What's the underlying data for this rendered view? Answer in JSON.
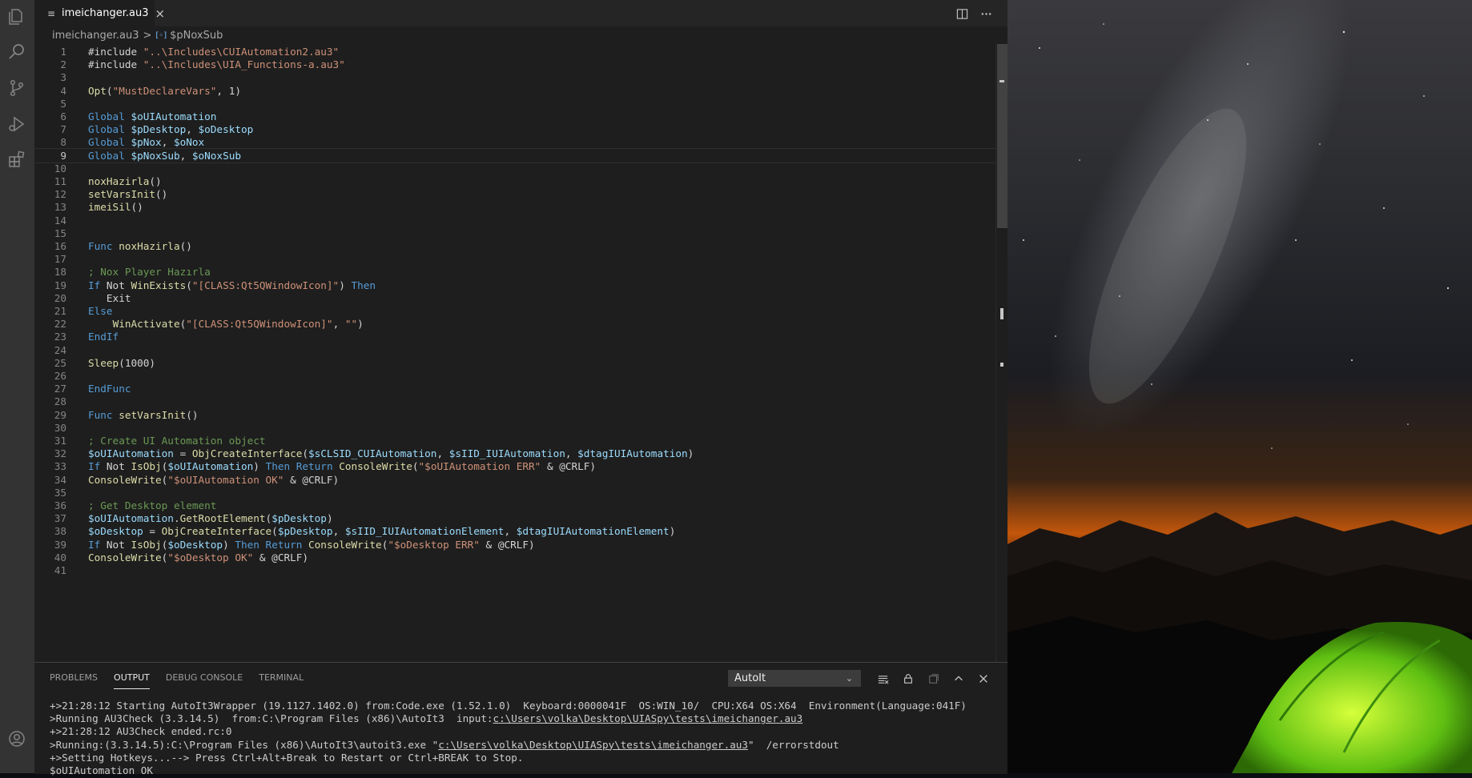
{
  "editor": {
    "tab_name": "imeichanger.au3",
    "tab_close_glyph": "×",
    "breadcrumb": {
      "file": "imeichanger.au3",
      "separator": ">",
      "symbol": "$pNoxSub"
    },
    "current_line": 9,
    "lines": [
      {
        "n": "1",
        "t": [
          [
            "pp",
            "#include "
          ],
          [
            "str",
            "\"..\\Includes\\CUIAutomation2.au3\""
          ]
        ]
      },
      {
        "n": "2",
        "t": [
          [
            "pp",
            "#include "
          ],
          [
            "str",
            "\"..\\Includes\\UIA_Functions-a.au3\""
          ]
        ]
      },
      {
        "n": "3",
        "t": []
      },
      {
        "n": "4",
        "t": [
          [
            "fn",
            "Opt"
          ],
          [
            "p",
            "("
          ],
          [
            "str",
            "\"MustDeclareVars\""
          ],
          [
            "p",
            ", 1)"
          ]
        ]
      },
      {
        "n": "5",
        "t": []
      },
      {
        "n": "6",
        "t": [
          [
            "kw",
            "Global "
          ],
          [
            "var",
            "$oUIAutomation"
          ]
        ]
      },
      {
        "n": "7",
        "t": [
          [
            "kw",
            "Global "
          ],
          [
            "var",
            "$pDesktop"
          ],
          [
            "p",
            ", "
          ],
          [
            "var",
            "$oDesktop"
          ]
        ]
      },
      {
        "n": "8",
        "t": [
          [
            "kw",
            "Global "
          ],
          [
            "var",
            "$pNox"
          ],
          [
            "p",
            ", "
          ],
          [
            "var",
            "$oNox"
          ]
        ]
      },
      {
        "n": "9",
        "t": [
          [
            "kw",
            "Global "
          ],
          [
            "var",
            "$pNoxSub"
          ],
          [
            "p",
            ", "
          ],
          [
            "var",
            "$oNoxSub"
          ]
        ]
      },
      {
        "n": "10",
        "t": []
      },
      {
        "n": "11",
        "t": [
          [
            "fn",
            "noxHazirla"
          ],
          [
            "p",
            "()"
          ]
        ]
      },
      {
        "n": "12",
        "t": [
          [
            "fn",
            "setVarsInit"
          ],
          [
            "p",
            "()"
          ]
        ]
      },
      {
        "n": "13",
        "t": [
          [
            "fn",
            "imeiSil"
          ],
          [
            "p",
            "()"
          ]
        ]
      },
      {
        "n": "14",
        "t": []
      },
      {
        "n": "15",
        "t": []
      },
      {
        "n": "16",
        "t": [
          [
            "kw",
            "Func "
          ],
          [
            "fn",
            "noxHazirla"
          ],
          [
            "p",
            "()"
          ]
        ]
      },
      {
        "n": "17",
        "t": []
      },
      {
        "n": "18",
        "t": [
          [
            "cm",
            "; Nox Player Hazırla"
          ]
        ]
      },
      {
        "n": "19",
        "t": [
          [
            "kw",
            "If "
          ],
          [
            "p",
            "Not "
          ],
          [
            "fn",
            "WinExists"
          ],
          [
            "p",
            "("
          ],
          [
            "str",
            "\"[CLASS:Qt5QWindowIcon]\""
          ],
          [
            "p",
            ") "
          ],
          [
            "kw",
            "Then"
          ]
        ]
      },
      {
        "n": "20",
        "t": [
          [
            "p",
            "   Exit"
          ]
        ]
      },
      {
        "n": "21",
        "t": [
          [
            "kw",
            "Else"
          ]
        ]
      },
      {
        "n": "22",
        "t": [
          [
            "p",
            "    "
          ],
          [
            "fn",
            "WinActivate"
          ],
          [
            "p",
            "("
          ],
          [
            "str",
            "\"[CLASS:Qt5QWindowIcon]\""
          ],
          [
            "p",
            ", "
          ],
          [
            "str",
            "\"\""
          ],
          [
            "p",
            ")"
          ]
        ]
      },
      {
        "n": "23",
        "t": [
          [
            "kw",
            "EndIf"
          ]
        ]
      },
      {
        "n": "24",
        "t": []
      },
      {
        "n": "25",
        "t": [
          [
            "fn",
            "Sleep"
          ],
          [
            "p",
            "(1000)"
          ]
        ]
      },
      {
        "n": "26",
        "t": []
      },
      {
        "n": "27",
        "t": [
          [
            "kw",
            "EndFunc"
          ]
        ]
      },
      {
        "n": "28",
        "t": []
      },
      {
        "n": "29",
        "t": [
          [
            "kw",
            "Func "
          ],
          [
            "fn",
            "setVarsInit"
          ],
          [
            "p",
            "()"
          ]
        ]
      },
      {
        "n": "30",
        "t": []
      },
      {
        "n": "31",
        "t": [
          [
            "cm",
            "; Create UI Automation object"
          ]
        ]
      },
      {
        "n": "32",
        "t": [
          [
            "var",
            "$oUIAutomation"
          ],
          [
            "p",
            " = "
          ],
          [
            "fn",
            "ObjCreateInterface"
          ],
          [
            "p",
            "("
          ],
          [
            "var",
            "$sCLSID_CUIAutomation"
          ],
          [
            "p",
            ", "
          ],
          [
            "var",
            "$sIID_IUIAutomation"
          ],
          [
            "p",
            ", "
          ],
          [
            "var",
            "$dtagIUIAutomation"
          ],
          [
            "p",
            ")"
          ]
        ]
      },
      {
        "n": "33",
        "t": [
          [
            "kw",
            "If "
          ],
          [
            "p",
            "Not "
          ],
          [
            "fn",
            "IsObj"
          ],
          [
            "p",
            "("
          ],
          [
            "var",
            "$oUIAutomation"
          ],
          [
            "p",
            ") "
          ],
          [
            "kw",
            "Then Return "
          ],
          [
            "fn",
            "ConsoleWrite"
          ],
          [
            "p",
            "("
          ],
          [
            "str",
            "\"$oUIAutomation ERR\""
          ],
          [
            "p",
            " & @CRLF)"
          ]
        ]
      },
      {
        "n": "34",
        "t": [
          [
            "fn",
            "ConsoleWrite"
          ],
          [
            "p",
            "("
          ],
          [
            "str",
            "\"$oUIAutomation OK\""
          ],
          [
            "p",
            " & @CRLF)"
          ]
        ]
      },
      {
        "n": "35",
        "t": []
      },
      {
        "n": "36",
        "t": [
          [
            "cm",
            "; Get Desktop element"
          ]
        ]
      },
      {
        "n": "37",
        "t": [
          [
            "var",
            "$oUIAutomation"
          ],
          [
            "p",
            "."
          ],
          [
            "fn",
            "GetRootElement"
          ],
          [
            "p",
            "("
          ],
          [
            "var",
            "$pDesktop"
          ],
          [
            "p",
            ")"
          ]
        ]
      },
      {
        "n": "38",
        "t": [
          [
            "var",
            "$oDesktop"
          ],
          [
            "p",
            " = "
          ],
          [
            "fn",
            "ObjCreateInterface"
          ],
          [
            "p",
            "("
          ],
          [
            "var",
            "$pDesktop"
          ],
          [
            "p",
            ", "
          ],
          [
            "var",
            "$sIID_IUIAutomationElement"
          ],
          [
            "p",
            ", "
          ],
          [
            "var",
            "$dtagIUIAutomationElement"
          ],
          [
            "p",
            ")"
          ]
        ]
      },
      {
        "n": "39",
        "t": [
          [
            "kw",
            "If "
          ],
          [
            "p",
            "Not "
          ],
          [
            "fn",
            "IsObj"
          ],
          [
            "p",
            "("
          ],
          [
            "var",
            "$oDesktop"
          ],
          [
            "p",
            ") "
          ],
          [
            "kw",
            "Then Return "
          ],
          [
            "fn",
            "ConsoleWrite"
          ],
          [
            "p",
            "("
          ],
          [
            "str",
            "\"$oDesktop ERR\""
          ],
          [
            "p",
            " & @CRLF)"
          ]
        ]
      },
      {
        "n": "40",
        "t": [
          [
            "fn",
            "ConsoleWrite"
          ],
          [
            "p",
            "("
          ],
          [
            "str",
            "\"$oDesktop OK\""
          ],
          [
            "p",
            " & @CRLF)"
          ]
        ]
      },
      {
        "n": "41",
        "t": []
      }
    ]
  },
  "panel": {
    "tabs": [
      "PROBLEMS",
      "OUTPUT",
      "DEBUG CONSOLE",
      "TERMINAL"
    ],
    "active_tab": "OUTPUT",
    "channel": "AutoIt",
    "output": [
      [
        [
          "t",
          "+>21:28:12 Starting AutoIt3Wrapper (19.1127.1402.0) from:Code.exe (1.52.1.0)  Keyboard:0000041F  OS:WIN_10/  CPU:X64 OS:X64  Environment(Language:041F)"
        ]
      ],
      [
        [
          "t",
          ">Running AU3Check (3.3.14.5)  from:C:\\Program Files (x86)\\AutoIt3  input:"
        ],
        [
          "u",
          "c:\\Users\\volka\\Desktop\\UIASpy\\tests\\imeichanger.au3"
        ]
      ],
      [
        [
          "t",
          "+>21:28:12 AU3Check ended.rc:0"
        ]
      ],
      [
        [
          "t",
          ">Running:(3.3.14.5):C:\\Program Files (x86)\\AutoIt3\\autoit3.exe \""
        ],
        [
          "u",
          "c:\\Users\\volka\\Desktop\\UIASpy\\tests\\imeichanger.au3"
        ],
        [
          "t",
          "\"  /errorstdout"
        ]
      ],
      [
        [
          "t",
          "+>Setting Hotkeys...--> Press Ctrl+Alt+Break to Restart or Ctrl+BREAK to Stop."
        ]
      ],
      [
        [
          "t",
          "$oUIAutomation OK"
        ]
      ]
    ]
  },
  "colors": {
    "editor_bg": "#1e1e1e",
    "activity_bar": "#333333",
    "keyword": "#569cd6",
    "variable": "#9cdcfe",
    "string": "#ce9178",
    "comment": "#6a9955",
    "function": "#dcdcaa"
  },
  "icons": {
    "activity_bar": [
      "explorer-icon",
      "search-icon",
      "source-control-icon",
      "run-debug-icon",
      "extensions-icon",
      "account-icon"
    ],
    "editor_actions": [
      "split-editor-icon",
      "more-actions-icon"
    ],
    "panel_actions": [
      "clear-output-icon",
      "lock-scroll-icon",
      "open-log-icon",
      "maximize-panel-icon",
      "close-panel-icon"
    ]
  }
}
